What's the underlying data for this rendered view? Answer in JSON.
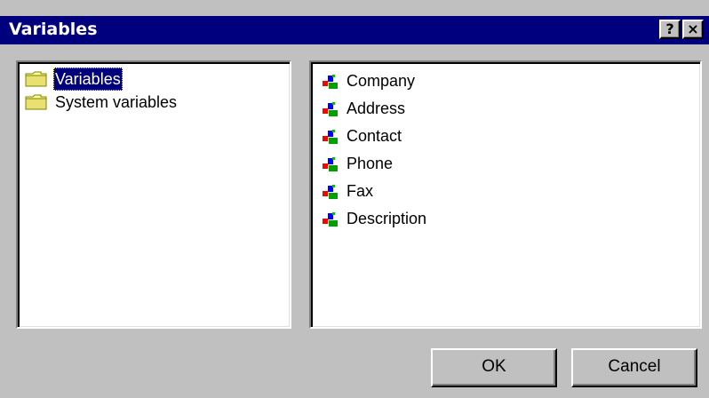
{
  "window": {
    "title": "Variables",
    "help_label": "?",
    "close_label": "×"
  },
  "tree": {
    "items": [
      {
        "label": "Variables",
        "icon": "folder-icon",
        "selected": true
      },
      {
        "label": "System variables",
        "icon": "folder-icon",
        "selected": false
      }
    ]
  },
  "list": {
    "items": [
      {
        "label": "Company",
        "icon": "variable-icon"
      },
      {
        "label": "Address",
        "icon": "variable-icon"
      },
      {
        "label": "Contact",
        "icon": "variable-icon"
      },
      {
        "label": "Phone",
        "icon": "variable-icon"
      },
      {
        "label": "Fax",
        "icon": "variable-icon"
      },
      {
        "label": "Description",
        "icon": "variable-icon"
      }
    ]
  },
  "buttons": {
    "ok_label": "OK",
    "cancel_label": "Cancel"
  },
  "colors": {
    "titlebar": "#00007f",
    "face": "#c0c0c0",
    "selection": "#00007f"
  }
}
